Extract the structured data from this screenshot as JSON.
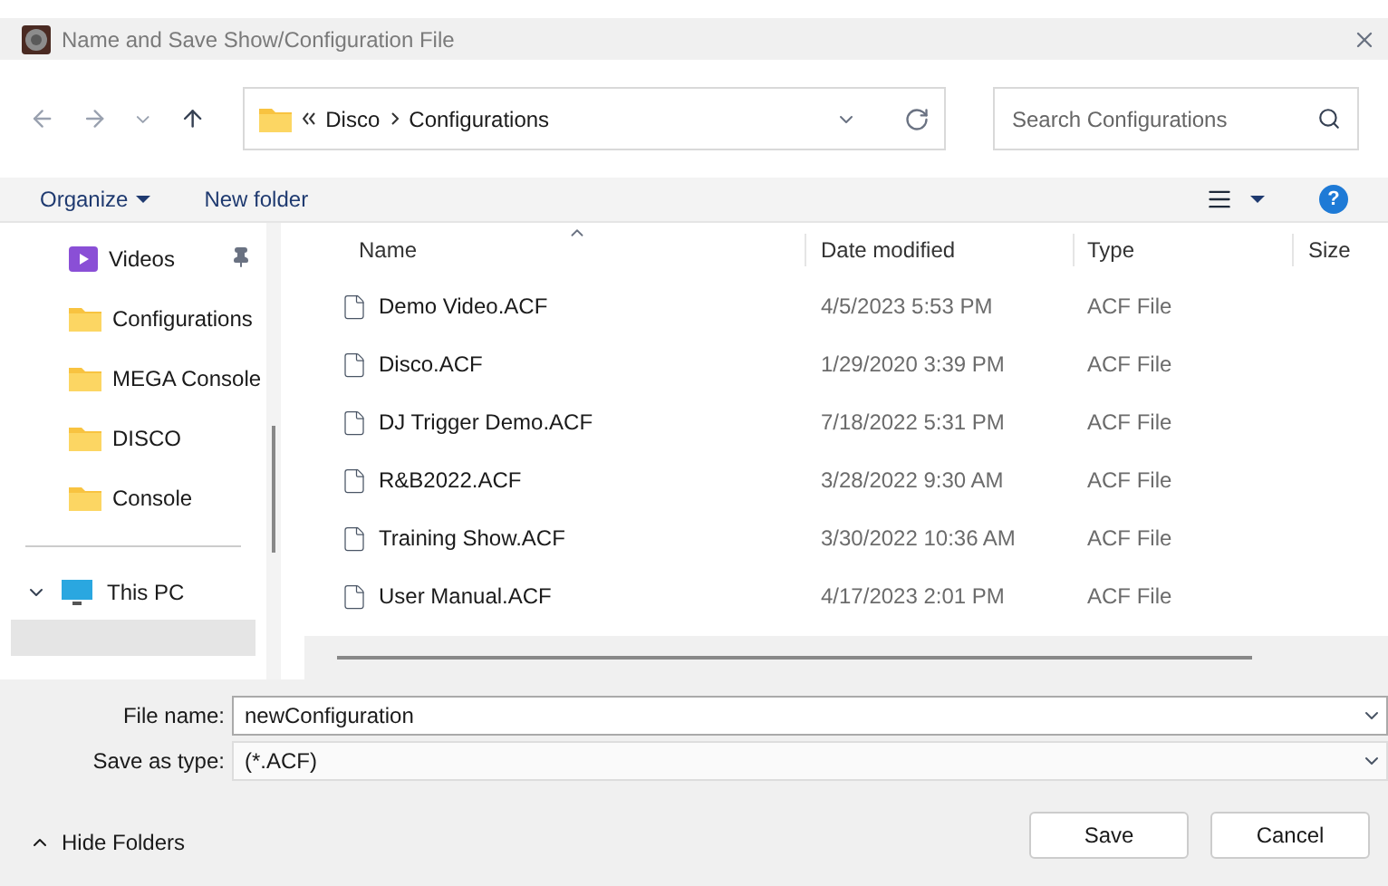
{
  "window": {
    "title": "Name and Save Show/Configuration File"
  },
  "address_bar": {
    "path": [
      "Disco",
      "Configurations"
    ]
  },
  "search": {
    "placeholder": "Search Configurations"
  },
  "toolbar": {
    "organize": "Organize",
    "new_folder": "New folder"
  },
  "sidebar": {
    "items": [
      {
        "label": "Videos",
        "kind": "videos",
        "pinned": true
      },
      {
        "label": "Configurations",
        "kind": "folder",
        "pinned": false
      },
      {
        "label": "MEGA Console",
        "kind": "folder",
        "pinned": false
      },
      {
        "label": "DISCO",
        "kind": "folder",
        "pinned": false
      },
      {
        "label": "Console",
        "kind": "folder",
        "pinned": false
      }
    ],
    "this_pc": {
      "label": "This PC",
      "expanded": true
    }
  },
  "table": {
    "columns": [
      "Name",
      "Date modified",
      "Type",
      "Size"
    ],
    "rows": [
      {
        "name": "Demo Video.ACF",
        "date": "4/5/2023 5:53 PM",
        "type": "ACF File"
      },
      {
        "name": "Disco.ACF",
        "date": "1/29/2020 3:39 PM",
        "type": "ACF File"
      },
      {
        "name": "DJ Trigger Demo.ACF",
        "date": "7/18/2022 5:31 PM",
        "type": "ACF File"
      },
      {
        "name": "R&B2022.ACF",
        "date": "3/28/2022 9:30 AM",
        "type": "ACF File"
      },
      {
        "name": "Training Show.ACF",
        "date": "3/30/2022 10:36 AM",
        "type": "ACF File"
      },
      {
        "name": "User Manual.ACF",
        "date": "4/17/2023 2:01 PM",
        "type": "ACF File"
      }
    ]
  },
  "file_name": {
    "label": "File name:",
    "value": "newConfiguration"
  },
  "save_as_type": {
    "label": "Save as type:",
    "value": "(*.ACF)"
  },
  "help": "?",
  "hide_folders": "Hide Folders",
  "buttons": [
    "Save",
    "Cancel"
  ]
}
